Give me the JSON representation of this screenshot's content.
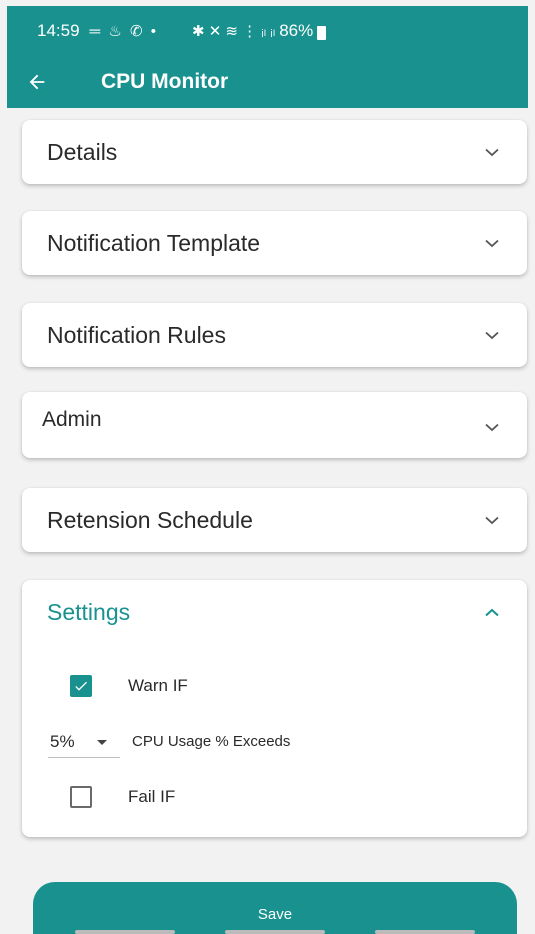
{
  "status_bar": {
    "time": "14:59",
    "left_icons": "═ ♨ ✆ •",
    "right_icons": "✱ ✕ ≋ ⋮ ᵢₗ ᵢₗ",
    "battery": "86%"
  },
  "app_bar": {
    "title": "CPU Monitor",
    "back_icon": "arrow-back-icon"
  },
  "sections": [
    {
      "label": "Details",
      "expanded": false
    },
    {
      "label": "Notification Template",
      "expanded": false
    },
    {
      "label": "Notification Rules",
      "expanded": false
    },
    {
      "label": "Admin",
      "expanded": false
    },
    {
      "label": "Retension Schedule",
      "expanded": false
    }
  ],
  "settings": {
    "title": "Settings",
    "expanded": true,
    "warn": {
      "label": "Warn IF",
      "checked": true
    },
    "threshold": {
      "value": "5%",
      "description": "CPU Usage % Exceeds"
    },
    "fail": {
      "label": "Fail IF",
      "checked": false
    }
  },
  "save_button": {
    "label": "Save"
  },
  "colors": {
    "primary": "#19928f",
    "background": "#f2f2f2",
    "card": "#ffffff"
  }
}
